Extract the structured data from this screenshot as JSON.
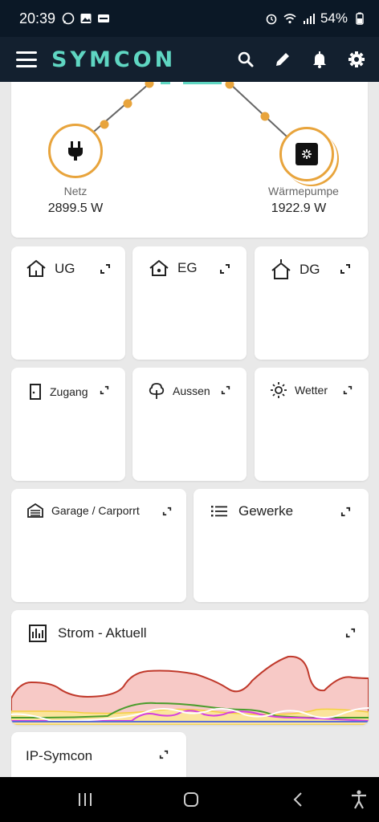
{
  "status": {
    "time": "20:39",
    "battery": "54%"
  },
  "app": {
    "logo": "SYMCON"
  },
  "energy": {
    "left_node": {
      "label": "Netz",
      "value": "2899.5 W",
      "icon": "plug-icon"
    },
    "right_node": {
      "label": "Wärmepumpe",
      "value": "1922.9 W",
      "icon": "heatpump-icon"
    }
  },
  "tiles_row1": [
    {
      "label": "UG",
      "icon": "house-down-icon"
    },
    {
      "label": "EG",
      "icon": "house-dot-icon"
    },
    {
      "label": "DG",
      "icon": "house-up-icon"
    }
  ],
  "tiles_row2": [
    {
      "label": "Zugang",
      "icon": "door-icon"
    },
    {
      "label": "Aussen",
      "icon": "tree-icon"
    },
    {
      "label": "Wetter",
      "icon": "sun-icon"
    }
  ],
  "tiles_row3": [
    {
      "label": "Garage / Carporrt",
      "icon": "garage-icon"
    },
    {
      "label": "Gewerke",
      "icon": "list-icon"
    }
  ],
  "chart_card": {
    "title": "Strom - Aktuell"
  },
  "bottom_card": {
    "title": "IP-Symcon"
  },
  "colors": {
    "accent": "#5fd6c2",
    "node_border": "#e8a43c",
    "appbar": "#13202f"
  }
}
